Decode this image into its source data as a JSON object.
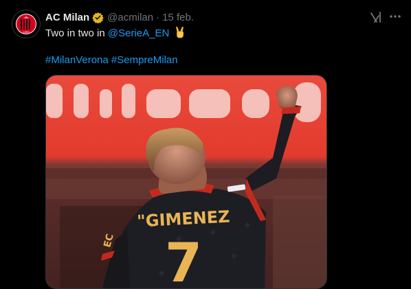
{
  "tweet": {
    "display_name": "AC Milan",
    "handle": "@acmilan",
    "separator": "·",
    "date": "15 feb.",
    "text_prefix": "Two in two in ",
    "mention": "@SerieA_EN",
    "hashtags": [
      "#MilanVerona",
      "#SempreMilan"
    ],
    "media_alt": "Player celebrating with raised fist"
  },
  "media": {
    "player_name": "\"GIMENEZ",
    "player_number": "7"
  },
  "colors": {
    "background": "#000000",
    "text": "#e7e9ea",
    "muted": "#71767b",
    "link": "#1d9bf0",
    "verified": "#e2b719",
    "milan_red": "#d3001e"
  },
  "icons": {
    "verified": "verified-badge-icon",
    "grok": "grok-icon",
    "more": "more-icon",
    "emoji": "victory-hand-emoji"
  }
}
